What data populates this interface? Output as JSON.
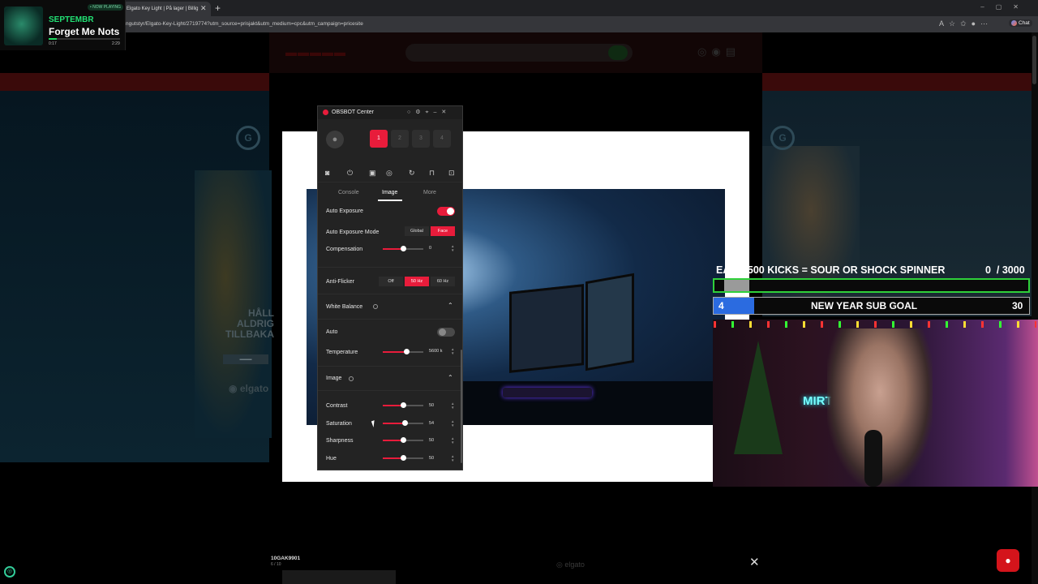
{
  "browser": {
    "tab_title": "Elgato Key Light | På lager | Billig",
    "url": "ngutstyr/Elgato-Key-Light/2719774?utm_source=prisjakt&utm_medium=cpc&utm_campaign=pricesite",
    "chat_label": "Chat"
  },
  "now_playing": {
    "badge": "• NOW PLAYING",
    "artist": "SEPTEMBR",
    "title": "Forget Me Nots",
    "current_time": "0:17",
    "duration": "2:29",
    "progress_fraction": 0.11
  },
  "site_banner": {
    "headline_lines": [
      "HÅLL",
      "ALDRIG",
      "TILLBAKA"
    ],
    "brand": "elgato"
  },
  "obsbot": {
    "app_title": "OBSBOT Center",
    "devices": [
      "1",
      "2",
      "3",
      "4"
    ],
    "selected_device": "1",
    "tabs": [
      "Console",
      "Image",
      "More"
    ],
    "active_tab": "Image",
    "auto_exposure": {
      "label": "Auto Exposure",
      "on": true
    },
    "auto_exposure_mode": {
      "label": "Auto Exposure Mode",
      "options": [
        "Global",
        "Face"
      ],
      "selected": "Face"
    },
    "compensation": {
      "label": "Compensation",
      "value": "0",
      "fraction": 0.5
    },
    "anti_flicker": {
      "label": "Anti-Flicker",
      "options": [
        "Off",
        "50 Hz",
        "60 Hz"
      ],
      "selected": "50 Hz"
    },
    "white_balance": {
      "title": "White Balance",
      "auto": {
        "label": "Auto",
        "on": false
      },
      "temperature": {
        "label": "Temperature",
        "value": "5600 k",
        "fraction": 0.58
      }
    },
    "image": {
      "title": "Image",
      "contrast": {
        "label": "Contrast",
        "value": "50",
        "fraction": 0.5
      },
      "saturation": {
        "label": "Saturation",
        "value": "54",
        "fraction": 0.54
      },
      "sharpness": {
        "label": "Sharpness",
        "value": "50",
        "fraction": 0.5
      },
      "hue": {
        "label": "Hue",
        "value": "50",
        "fraction": 0.5
      }
    }
  },
  "product_strip": {
    "sku": "10GAK9901",
    "count": "6 / 10",
    "brand": "elgato"
  },
  "stream_overlay": {
    "kicks_goal": {
      "text": "EACH 500 KICKS = SOUR OR SHOCK SPINNER",
      "current": "0",
      "target": "/ 3000"
    },
    "sub_goal": {
      "text": "NEW YEAR SUB GOAL",
      "current": "4",
      "target": "30"
    },
    "neon_sign": "MIRTUR"
  },
  "colors": {
    "accent": "#e81c3b",
    "goal_green": "#2fd03a",
    "goal_blue": "#2b6be0",
    "spotify_green": "#1ed760"
  }
}
